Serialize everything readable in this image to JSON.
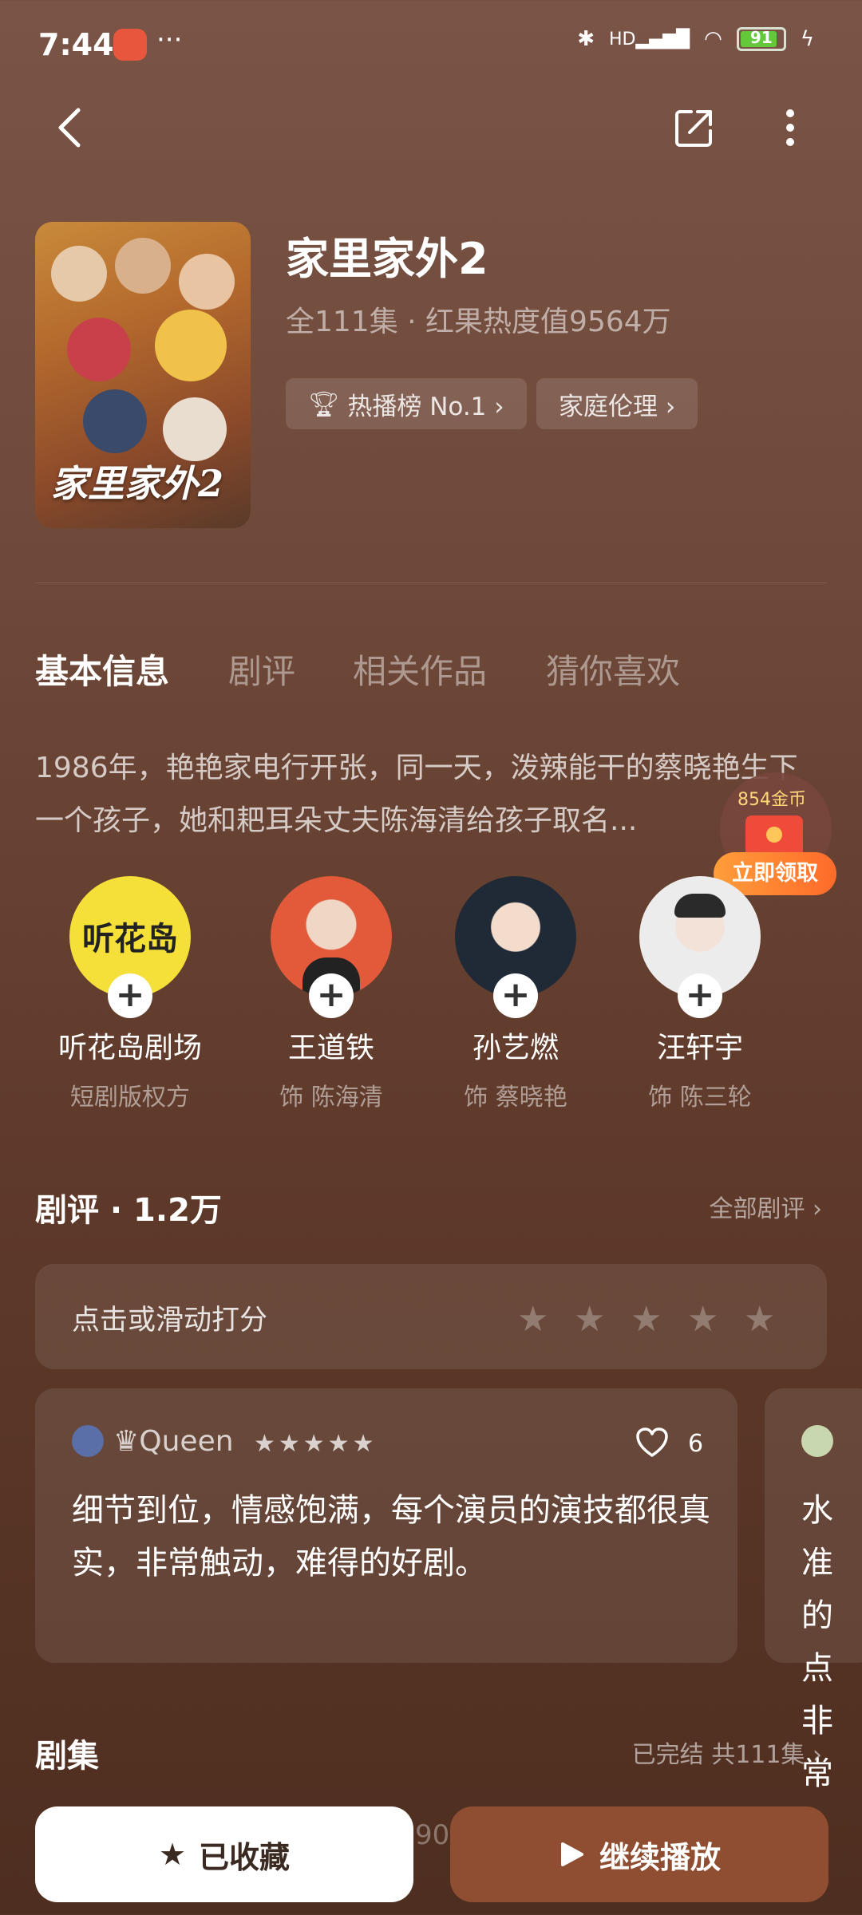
{
  "status": {
    "time": "7:44",
    "dots": "···",
    "battery": "91",
    "signal_label": "HD"
  },
  "show": {
    "title": "家里家外2",
    "meta": "全111集 · 红果热度值9564万",
    "poster_text": "家里家外2",
    "chips": [
      {
        "label": "热播榜 No.1 ›"
      },
      {
        "label": "家庭伦理 ›"
      }
    ]
  },
  "tabs": [
    "基本信息",
    "剧评",
    "相关作品",
    "猜你喜欢"
  ],
  "description": "1986年，艳艳家电行开张，同一天，泼辣能干的蔡晓艳生下一个孩子，她和耙耳朵丈夫陈海清给孩子取名...",
  "coin_promo": {
    "amount": "854金币",
    "button": "立即领取"
  },
  "cast": [
    {
      "name": "听花岛剧场",
      "role": "短剧版权方",
      "logo": "听花岛"
    },
    {
      "name": "王道铁",
      "role": "饰 陈海清"
    },
    {
      "name": "孙艺燃",
      "role": "饰 蔡晓艳"
    },
    {
      "name": "汪轩宇",
      "role": "饰 陈三轮"
    }
  ],
  "reviews": {
    "title": "剧评 · 1.2万",
    "link": "全部剧评 ›",
    "rate_prompt": "点击或滑动打分",
    "items": [
      {
        "user": "♛Queen",
        "stars": "★★★★★",
        "likes": "6",
        "text": "细节到位，情感饱满，每个演员的演技都很真实，非常触动，难得的好剧。"
      },
      {
        "text": "水准\n的点\n非常"
      }
    ]
  },
  "episodes": {
    "title": "剧集",
    "link": "已完结 共111集 ›",
    "peek": "90"
  },
  "actions": {
    "favorite": "已收藏",
    "play": "继续播放"
  },
  "colors": {
    "accent_button": "#8f4e32",
    "badge_orange": "#ff6b2a"
  }
}
